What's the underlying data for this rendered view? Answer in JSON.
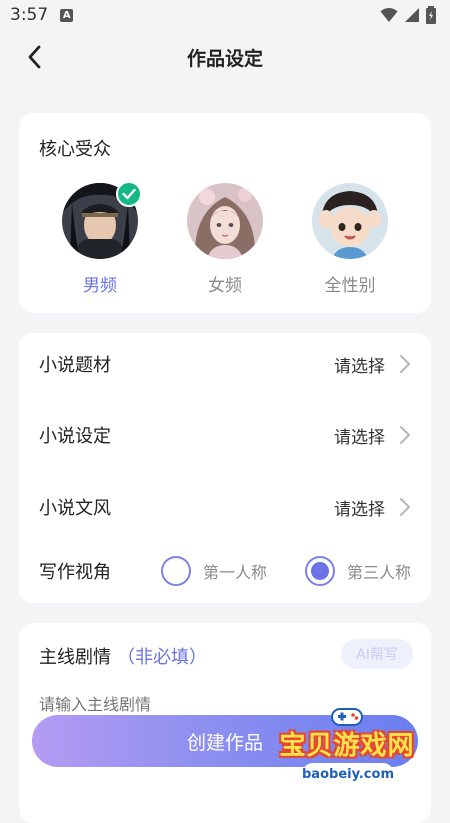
{
  "status_bar": {
    "time": "3:57",
    "notification_letter": "A"
  },
  "header": {
    "title": "作品设定"
  },
  "audience": {
    "title": "核心受众",
    "options": [
      {
        "label": "男频",
        "selected": true
      },
      {
        "label": "女频",
        "selected": false
      },
      {
        "label": "全性别",
        "selected": false
      }
    ]
  },
  "settings": {
    "rows": [
      {
        "label": "小说题材",
        "value": "请选择"
      },
      {
        "label": "小说设定",
        "value": "请选择"
      },
      {
        "label": "小说文风",
        "value": "请选择"
      }
    ],
    "perspective": {
      "label": "写作视角",
      "options": [
        {
          "label": "第一人称",
          "selected": false
        },
        {
          "label": "第三人称",
          "selected": true
        }
      ]
    }
  },
  "plot": {
    "title": "主线剧情",
    "optional_note": "（非必填）",
    "ai_button": "AI帮写",
    "placeholder": "请输入主线剧情"
  },
  "footer": {
    "create_button": "创建作品"
  },
  "watermark": {
    "text": "宝贝游戏网",
    "url": "baobeiy.com"
  },
  "colors": {
    "accent": "#6b73e6",
    "check_green": "#12b886",
    "background": "#f4f4f6"
  }
}
